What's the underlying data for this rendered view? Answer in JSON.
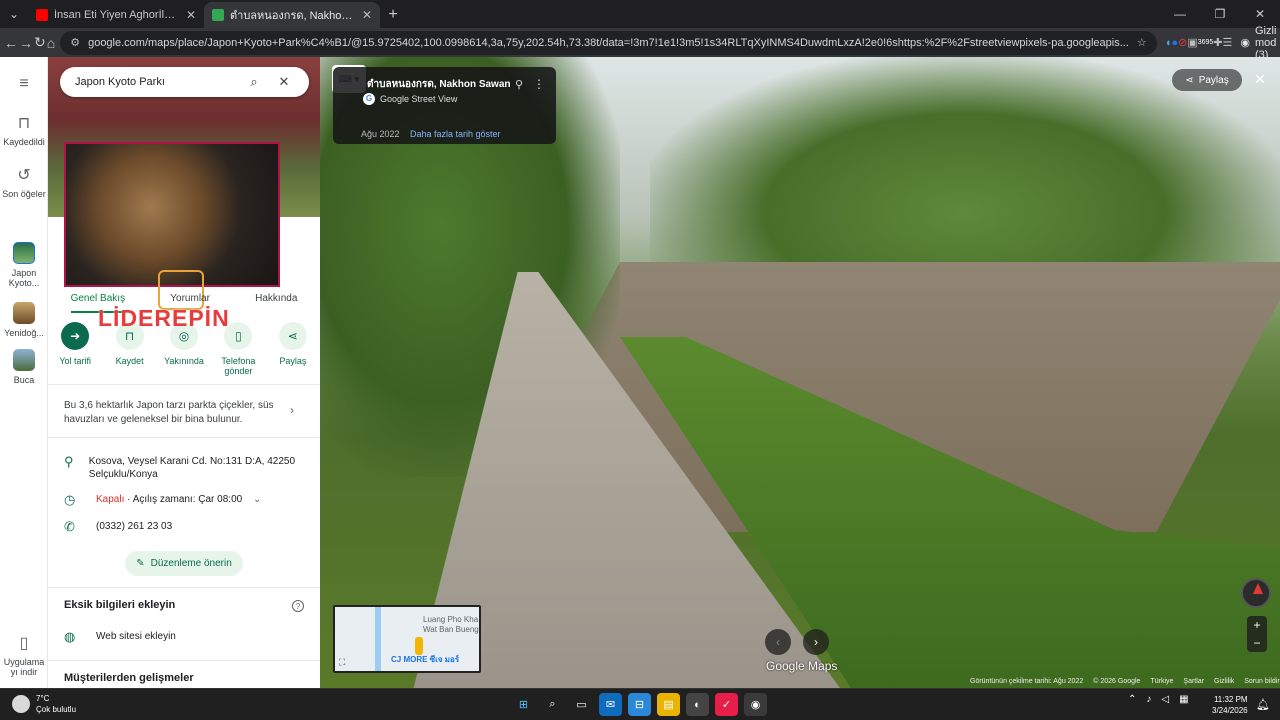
{
  "browser": {
    "tabs": [
      {
        "title": "İnsan Eti Yiyen Aghorİler | Ölüle",
        "fav_color": "#ff0000",
        "active": false
      },
      {
        "title": "ตำบลหนองกรด, Nakhon Sawan",
        "fav_color": "#34a853",
        "active": true
      }
    ],
    "new_tab": "+",
    "url": "google.com/maps/place/Japon+Kyoto+Park%C4%B1/@15.9725402,100.0998614,3a,75y,202.54h,73.38t/data=!3m7!1e1!3m5!1s34RLTqXyINMS4DuwdmLxzA!2e0!6shttps:%2F%2Fstreetviewpixels-pa.googleapis...",
    "ext_badge": "3695",
    "incognito_label": "Gizli mod (3)"
  },
  "rail": {
    "menu": "≡",
    "items": [
      {
        "label": "Kaydedildi",
        "icon": "bookmark-icon"
      },
      {
        "label": "Son öğeler",
        "icon": "history-icon"
      },
      {
        "label": "Japon Kyoto...",
        "icon": "thumb"
      },
      {
        "label": "Yenidoğ...",
        "icon": "thumb"
      },
      {
        "label": "Buca",
        "icon": "thumb"
      }
    ],
    "app_label": "Uygulama yı indir"
  },
  "panel": {
    "search_value": "Japon Kyoto Parkı",
    "tabs": [
      "Genel Bakış",
      "Yorumlar",
      "Hakkında"
    ],
    "actions": [
      {
        "label": "Yol tarifi",
        "icon": "directions-icon"
      },
      {
        "label": "Kaydet",
        "icon": "bookmark-icon"
      },
      {
        "label": "Yakınında",
        "icon": "nearby-icon"
      },
      {
        "label": "Telefona gönder",
        "icon": "phone-send-icon"
      },
      {
        "label": "Paylaş",
        "icon": "share-icon"
      }
    ],
    "watermark": "LİDEREPİN",
    "description": "Bu 3,6 hektarlık Japon tarzı parkta çiçekler, süs havuzları ve geleneksel bir bina bulunur.",
    "address": "Kosova, Veysel Karani Cd. No:131 D:A, 42250 Selçuklu/Konya",
    "hours_status": "Kapalı",
    "hours_text": " · Açılış zamanı: Çar 08:00",
    "phone": "(0332) 261 23 03",
    "suggest_edit": "Düzenleme önerin",
    "missing_info_title": "Eksik bilgileri ekleyin",
    "add_website": "Web sitesi ekleyin",
    "owner_updates": "Müşterilerden gelişmeler"
  },
  "streetview": {
    "place_title": "ตำบลหนองกรด, Nakhon Sawan",
    "source": "Google Street View",
    "date": "Ağu 2022",
    "more_dates": "Daha fazla tarih göster",
    "share": "Paylaş",
    "logo": "Google Maps",
    "minimap": {
      "line1": "Luang Pho Kha",
      "line2": "Wat Ban Bueng",
      "line3": "CJ MORE ซีเจ มอร์"
    },
    "footer": [
      "Görüntünün çekilme tarihi: Ağu 2022",
      "© 2026 Google",
      "Türkiye",
      "Şartlar",
      "Gizlilik",
      "Sorun bildir"
    ]
  },
  "taskbar": {
    "temp": "7°C",
    "weather": "Çok bulutlu",
    "time": "11:32 PM",
    "date": "3/24/2026"
  },
  "colors": {
    "accent": "#0b6b4e",
    "closed": "#d93025",
    "link": "#8ab4f8"
  }
}
